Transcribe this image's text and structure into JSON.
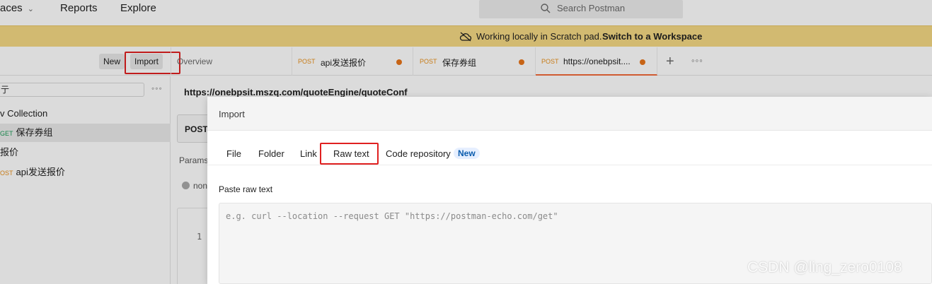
{
  "topnav": {
    "workspaces_label": "aces",
    "reports_label": "Reports",
    "explore_label": "Explore",
    "search_placeholder": "Search Postman"
  },
  "banner": {
    "message": "Working locally in Scratch pad.",
    "link": "Switch to a Workspace"
  },
  "toolbar": {
    "new_label": "New",
    "import_label": "Import"
  },
  "tabs": [
    {
      "label": "Overview"
    },
    {
      "method": "POST",
      "label": "api发送报价"
    },
    {
      "method": "POST",
      "label": "保存券组"
    },
    {
      "method": "POST",
      "label": "https://onebpsit...."
    }
  ],
  "sidebar": {
    "filter_value": "亍",
    "items": [
      {
        "label": "v Collection"
      },
      {
        "method": "GET",
        "label": "保存券组"
      },
      {
        "label": "报价"
      },
      {
        "method": "OST",
        "label": "api发送报价"
      }
    ]
  },
  "request": {
    "url": "https://onebpsit.mszq.com/quoteEngine/quoteConf",
    "method": "POST",
    "params_label": "Params",
    "radio_label": "non",
    "line_number": "1"
  },
  "modal": {
    "title": "Import",
    "tabs": [
      "File",
      "Folder",
      "Link",
      "Raw text",
      "Code repository"
    ],
    "new_badge": "New",
    "paste_label": "Paste raw text",
    "placeholder": "e.g. curl --location --request GET \"https://postman-echo.com/get\""
  },
  "watermark": "CSDN @ling_zero0108",
  "colors": {
    "banner": "#f5d984",
    "highlight": "#e02020",
    "method_post": "#e8901a",
    "method_get": "#1a9b57",
    "unsaved_dot": "#e8751a",
    "badge_bg": "#e6efff",
    "badge_text": "#0b5cad"
  }
}
